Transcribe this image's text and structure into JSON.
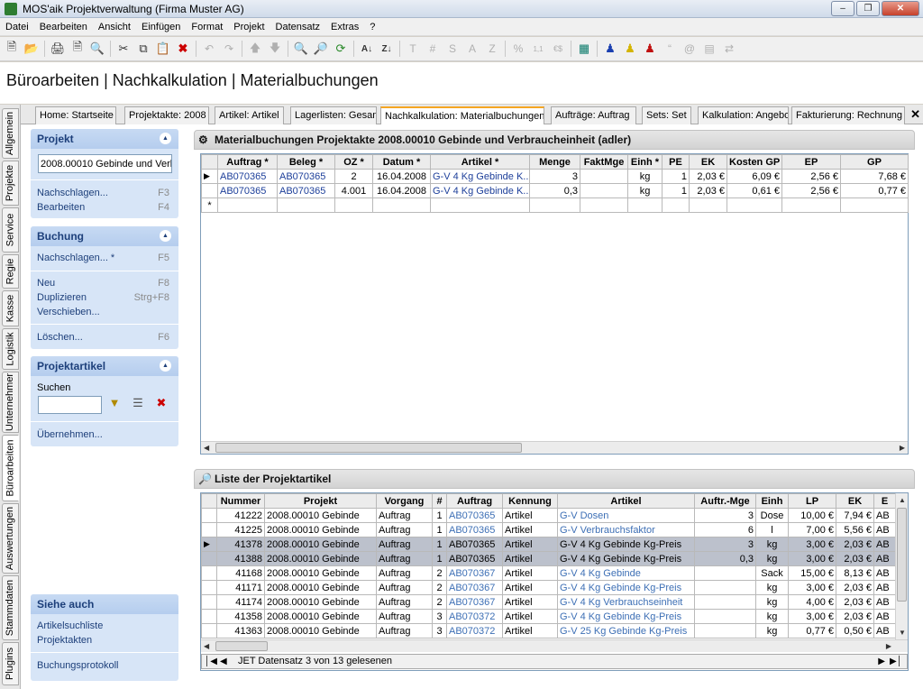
{
  "window": {
    "title": "MOS'aik Projektverwaltung (Firma Muster AG)"
  },
  "menu": [
    "Datei",
    "Bearbeiten",
    "Ansicht",
    "Einfügen",
    "Format",
    "Projekt",
    "Datensatz",
    "Extras",
    "?"
  ],
  "toolbar": {
    "disabled_labels": [
      "T",
      "#",
      "S",
      "A",
      "Z",
      "%",
      "€$"
    ]
  },
  "page_title": "Büroarbeiten | Nachkalkulation | Materialbuchungen",
  "vtabs": [
    "Allgemein",
    "Projekte",
    "Service",
    "Regie",
    "Kasse",
    "Logistik",
    "Unternehmer",
    "Büroarbeiten",
    "Auswertungen",
    "Stammdaten",
    "Plugins"
  ],
  "tabs": [
    "Home: Startseite",
    "Projektakte: 2008",
    "Artikel: Artikel",
    "Lagerlisten: Gesam",
    "Nachkalkulation: Materialbuchungen",
    "Aufträge: Auftrag",
    "Sets: Set",
    "Kalkulation: Angebo",
    "Fakturierung: Rechnung"
  ],
  "left": {
    "projekt": {
      "title": "Projekt",
      "input": "2008.00010 Gebinde und Verb",
      "nachschlagen": "Nachschlagen...",
      "nachschlagen_key": "F3",
      "bearbeiten": "Bearbeiten",
      "bearbeiten_key": "F4"
    },
    "buchung": {
      "title": "Buchung",
      "nachschlagen": "Nachschlagen... *",
      "nachschlagen_key": "F5",
      "neu": "Neu",
      "neu_key": "F8",
      "duplizieren": "Duplizieren",
      "duplizieren_key": "Strg+F8",
      "verschieben": "Verschieben...",
      "loeschen": "Löschen...",
      "loeschen_key": "F6"
    },
    "projektartikel": {
      "title": "Projektartikel",
      "suchen": "Suchen",
      "uebernehmen": "Übernehmen..."
    },
    "siehe": {
      "title": "Siehe auch",
      "artikelsuchliste": "Artikelsuchliste",
      "projektakten": "Projektakten",
      "buchungsprotokoll": "Buchungsprotokoll"
    }
  },
  "top_grid": {
    "title": "Materialbuchungen Projektakte 2008.00010 Gebinde und Verbraucheinheit (adler)",
    "headers": [
      "Auftrag *",
      "Beleg *",
      "OZ *",
      "Datum *",
      "Artikel *",
      "Menge",
      "FaktMge",
      "Einh *",
      "PE",
      "EK",
      "Kosten GP",
      "EP",
      "GP"
    ],
    "rows": [
      [
        "AB070365",
        "AB070365",
        "2",
        "16.04.2008",
        "G-V 4 Kg Gebinde K...",
        "3",
        "",
        "kg",
        "1",
        "2,03 €",
        "6,09 €",
        "2,56 €",
        "7,68 €"
      ],
      [
        "AB070365",
        "AB070365",
        "4.001",
        "16.04.2008",
        "G-V 4 Kg Gebinde K...",
        "0,3",
        "",
        "kg",
        "1",
        "2,03 €",
        "0,61 €",
        "2,56 €",
        "0,77 €"
      ]
    ],
    "new_row_marker": "*"
  },
  "bottom_grid": {
    "title": "Liste der Projektartikel",
    "headers": [
      "Nummer",
      "Projekt",
      "Vorgang",
      "#",
      "Auftrag",
      "Kennung",
      "Artikel",
      "Auftr.-Mge",
      "Einh",
      "LP",
      "EK",
      "E"
    ],
    "rows": [
      [
        "41222",
        "2008.00010 Gebinde",
        "Auftrag",
        "1",
        "AB070365",
        "Artikel",
        "G-V Dosen",
        "3",
        "Dose",
        "10,00 €",
        "7,94 €",
        "AB"
      ],
      [
        "41225",
        "2008.00010 Gebinde",
        "Auftrag",
        "1",
        "AB070365",
        "Artikel",
        "G-V Verbrauchsfaktor",
        "6",
        "l",
        "7,00 €",
        "5,56 €",
        "AB"
      ],
      [
        "41378",
        "2008.00010 Gebinde",
        "Auftrag",
        "1",
        "AB070365",
        "Artikel",
        "G-V 4 Kg Gebinde Kg-Preis",
        "3",
        "kg",
        "3,00 €",
        "2,03 €",
        "AB"
      ],
      [
        "41388",
        "2008.00010 Gebinde",
        "Auftrag",
        "1",
        "AB070365",
        "Artikel",
        "G-V 4 Kg Gebinde Kg-Preis",
        "0,3",
        "kg",
        "3,00 €",
        "2,03 €",
        "AB"
      ],
      [
        "41168",
        "2008.00010 Gebinde",
        "Auftrag",
        "2",
        "AB070367",
        "Artikel",
        "G-V 4 Kg Gebinde",
        "",
        "Sack",
        "15,00 €",
        "8,13 €",
        "AB"
      ],
      [
        "41171",
        "2008.00010 Gebinde",
        "Auftrag",
        "2",
        "AB070367",
        "Artikel",
        "G-V 4 Kg Gebinde Kg-Preis",
        "",
        "kg",
        "3,00 €",
        "2,03 €",
        "AB"
      ],
      [
        "41174",
        "2008.00010 Gebinde",
        "Auftrag",
        "2",
        "AB070367",
        "Artikel",
        "G-V 4 Kg Verbrauchseinheit",
        "",
        "kg",
        "4,00 €",
        "2,03 €",
        "AB"
      ],
      [
        "41358",
        "2008.00010 Gebinde",
        "Auftrag",
        "3",
        "AB070372",
        "Artikel",
        "G-V 4 Kg Gebinde Kg-Preis",
        "",
        "kg",
        "3,00 €",
        "2,03 €",
        "AB"
      ],
      [
        "41363",
        "2008.00010 Gebinde",
        "Auftrag",
        "3",
        "AB070372",
        "Artikel",
        "G-V 25 Kg Gebinde Kg-Preis",
        "",
        "kg",
        "0,77 €",
        "0,50 €",
        "AB"
      ]
    ],
    "status": "JET Datensatz 3 von 13 gelesenen"
  }
}
